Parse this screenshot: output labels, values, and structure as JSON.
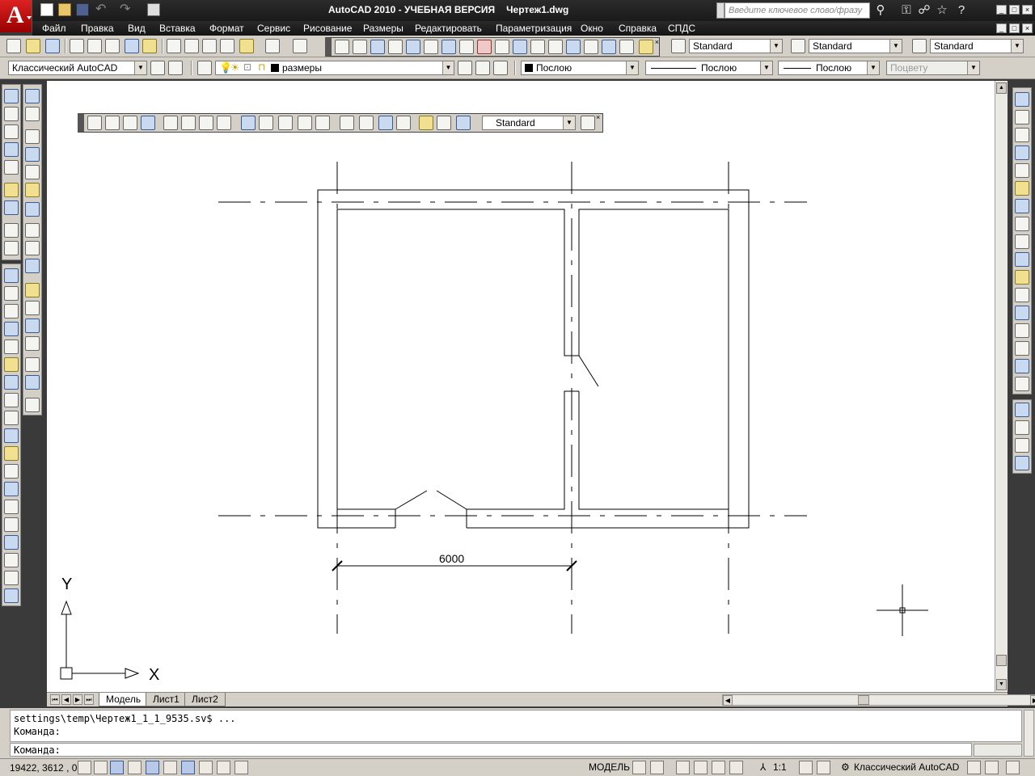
{
  "window": {
    "title": "AutoCAD 2010 - УЧЕБНАЯ ВЕРСИЯ",
    "document": "Чертеж1.dwg",
    "search_placeholder": "Введите ключевое слово/фразу"
  },
  "menu": [
    "Файл",
    "Правка",
    "Вид",
    "Вставка",
    "Формат",
    "Сервис",
    "Рисование",
    "Размеры",
    "Редактировать",
    "Параметризация",
    "Окно",
    "Справка",
    "СПДС"
  ],
  "styles_toolbar": {
    "text_style": "Standard",
    "dim_style": "Standard",
    "table_style": "Standard"
  },
  "workspace_toolbar": {
    "workspace": "Классический AutoCAD",
    "layer": "размеры",
    "color": "Послою",
    "linetype": "Послою",
    "lineweight": "Послою",
    "plotstyle": "Поцвету"
  },
  "dim_toolbar": {
    "dim_style": "Standard"
  },
  "drawing": {
    "dimension_text": "6000",
    "ucs_x": "X",
    "ucs_y": "Y"
  },
  "layout_tabs": [
    "Модель",
    "Лист1",
    "Лист2"
  ],
  "command_line": {
    "history": [
      "settings\\temp\\Чертеж1_1_1_9535.sv$ ...",
      "Команда:"
    ],
    "prompt": "Команда:"
  },
  "status_bar": {
    "coordinates": "19422, 3612 , 0",
    "model_label": "МОДЕЛЬ",
    "scale": "1:1",
    "workspace": "Классический AutoCAD"
  },
  "colors": {
    "title_bg": "#1a1a1a",
    "toolbar_bg": "#d4d0c8",
    "canvas_bg": "#ffffff",
    "logo_red": "#cc2222"
  }
}
